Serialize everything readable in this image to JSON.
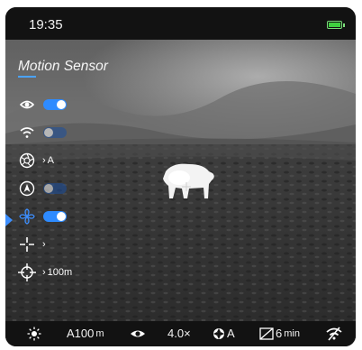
{
  "status_bar": {
    "time": "19:35",
    "battery_color": "#3fd23f"
  },
  "menu": {
    "title": "Motion Sensor",
    "accent": "#2e8bff",
    "items": [
      {
        "icon": "eye-icon",
        "control": "toggle",
        "state": "on"
      },
      {
        "icon": "wifi-icon",
        "control": "toggle",
        "state": "off"
      },
      {
        "icon": "color-palette-icon",
        "control": "submenu",
        "value": "A"
      },
      {
        "icon": "auto-calibration-icon",
        "control": "toggle",
        "state": "off"
      },
      {
        "icon": "motion-sensor-icon",
        "control": "toggle",
        "state": "on",
        "selected": true
      },
      {
        "icon": "reticle-icon",
        "control": "submenu",
        "value": ""
      },
      {
        "icon": "zeroing-icon",
        "control": "submenu",
        "value": "100m"
      }
    ]
  },
  "bottom_bar": {
    "brightness_icon": "brightness-icon",
    "profile": "A100",
    "profile_unit": "m",
    "eye_icon": "eye-icon",
    "zoom": "4.0×",
    "calibration_mode": "A",
    "timer": "6",
    "timer_unit": "min",
    "wifi_off_icon": "wifi-off-icon"
  }
}
